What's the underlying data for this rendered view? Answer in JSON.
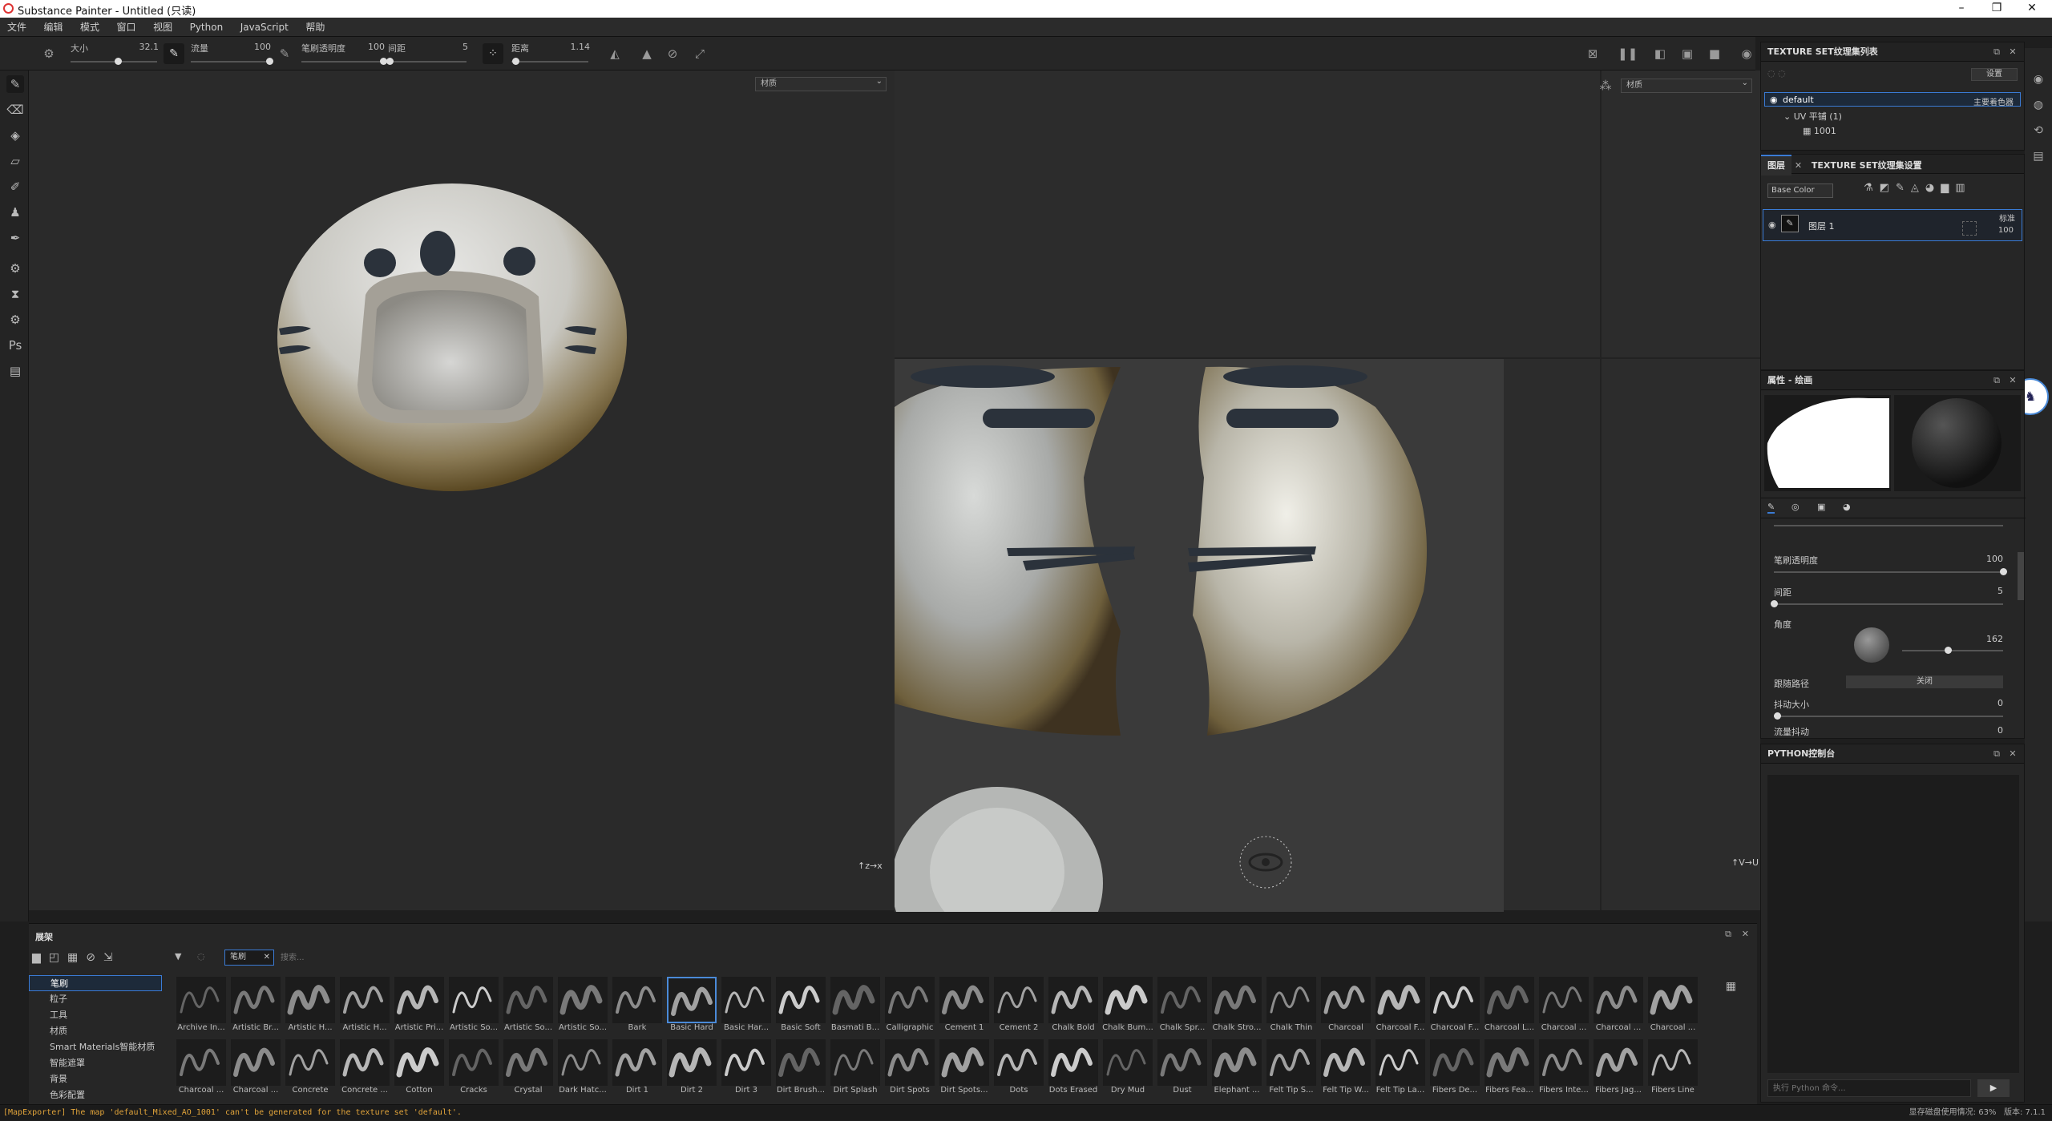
{
  "window": {
    "title": "Substance Painter - Untitled (只读)"
  },
  "menu": [
    "文件",
    "编辑",
    "模式",
    "窗口",
    "视图",
    "Python",
    "JavaScript",
    "帮助"
  ],
  "toolbar": {
    "size_label": "大小",
    "size_value": "32.1",
    "size_fraction": 0.55,
    "flow_label": "流量",
    "flow_value": "100",
    "flow_fraction": 1.0,
    "opacity_label": "笔刷透明度",
    "opacity_value": "100",
    "opacity_fraction": 1.0,
    "spacing_label": "间距",
    "spacing_value": "5",
    "spacing_fraction": 0.02,
    "distance_label": "距离",
    "distance_value": "1.14",
    "distance_fraction": 0.05
  },
  "viewport3d": {
    "material_dropdown": "材质"
  },
  "viewport2d": {
    "material_dropdown": "材质"
  },
  "texture_sets": {
    "title": "TEXTURE SET纹理集列表",
    "settings_btn": "设置",
    "set_name": "default",
    "shader_label": "主要着色器",
    "uv_label": "UV 平铺 (1)",
    "tile_label": "1001"
  },
  "layers": {
    "tab_layers": "图层",
    "tab_settings": "TEXTURE SET纹理集设置",
    "channel_dropdown": "Base Color",
    "layer_name": "图层 1",
    "blend_mode": "标准",
    "layer_opacity": "100"
  },
  "properties": {
    "title": "属性 - 绘画",
    "opacity_label": "笔刷透明度",
    "opacity_value": "100",
    "opacity_fraction": 1.0,
    "spacing_label": "间距",
    "spacing_value": "5",
    "spacing_fraction": 0.0,
    "angle_label": "角度",
    "angle_value": "162",
    "angle_fraction": 0.45,
    "follow_path_label": "跟随路径",
    "follow_path_value": "关闭",
    "jitter_size_label": "抖动大小",
    "jitter_size_value": "0",
    "flow_jitter_label": "流量抖动",
    "flow_jitter_value": "0"
  },
  "python_console": {
    "title": "PYTHON控制台",
    "input_placeholder": "执行 Python 命令..."
  },
  "shelf": {
    "title": "展架",
    "filter_tag": "笔刷",
    "search_placeholder": "搜索...",
    "categories": [
      "笔刷",
      "粒子",
      "工具",
      "材质",
      "Smart Materials智能材质",
      "智能遮罩",
      "背景",
      "色彩配置"
    ],
    "selected_category": 0,
    "brushes_row1": [
      "Archive In...",
      "Artistic Br...",
      "Artistic H...",
      "Artistic H...",
      "Artistic Pri...",
      "Artistic So...",
      "Artistic So...",
      "Artistic So...",
      "Bark",
      "Basic Hard",
      "Basic Har...",
      "Basic Soft",
      "Basmati B...",
      "Calligraphic",
      "Cement 1",
      "Cement 2",
      "Chalk Bold",
      "Chalk Bum...",
      "Chalk Spr...",
      "Chalk Stro...",
      "Chalk Thin",
      "Charcoal",
      "Charcoal F...",
      "Charcoal F...",
      "Charcoal L...",
      "Charcoal ...",
      "Charcoal ...",
      "Charcoal ..."
    ],
    "brushes_row2": [
      "Charcoal ...",
      "Charcoal ...",
      "Concrete",
      "Concrete ...",
      "Cotton",
      "Cracks",
      "Crystal",
      "Dark Hatc...",
      "Dirt 1",
      "Dirt 2",
      "Dirt 3",
      "Dirt Brush...",
      "Dirt Splash",
      "Dirt Spots",
      "Dirt Spots...",
      "Dots",
      "Dots Erased",
      "Dry Mud",
      "Dust",
      "Elephant ...",
      "Felt Tip S...",
      "Felt Tip W...",
      "Felt Tip La...",
      "Fibers De...",
      "Fibers Fea...",
      "Fibers Inte...",
      "Fibers Jag...",
      "Fibers Line"
    ],
    "selected_brush": "Basic Hard"
  },
  "status": {
    "message": "[MapExporter] The map 'default_Mixed_AO_1001' can't be generated for the texture set 'default'.",
    "memory_label": "显存磁盘使用情况:",
    "memory_value": "63%",
    "version_label": "版本:",
    "version_value": "7.1.1"
  },
  "colors": {
    "accent": "#3a7bd5",
    "warning_text": "#e0a33a",
    "panel_bg": "#262626"
  }
}
